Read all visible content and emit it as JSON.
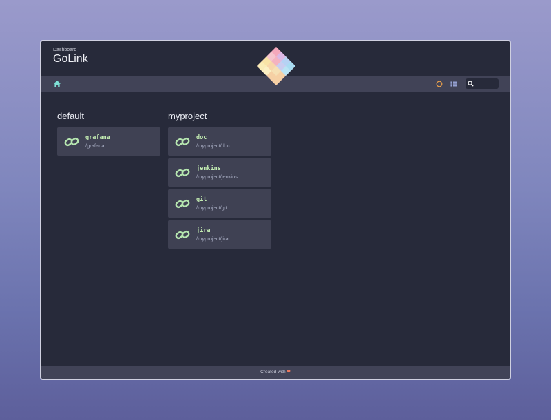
{
  "header": {
    "subtitle": "Dashboard",
    "title": "GoLink"
  },
  "search": {
    "placeholder": ""
  },
  "groups": [
    {
      "title": "default",
      "links": [
        {
          "name": "grafana",
          "path": "/grafana"
        }
      ]
    },
    {
      "title": "myproject",
      "links": [
        {
          "name": "doc",
          "path": "/myproject/doc"
        },
        {
          "name": "jenkins",
          "path": "/myproject/jenkins"
        },
        {
          "name": "git",
          "path": "/myproject/git"
        },
        {
          "name": "jira",
          "path": "/myproject/jira"
        }
      ]
    }
  ],
  "footer": {
    "text": "Created with",
    "heart": "❤"
  },
  "colors": {
    "background": "#272a3a",
    "navbar": "#414357",
    "card": "#3f4153",
    "link_name": "#c3ecb2",
    "link_icon": "#b6e6b0",
    "accent_home": "#7fe0d6",
    "theme_circle": "#f0a34a"
  },
  "icons": {
    "home": "home-icon",
    "theme": "theme-toggle-icon",
    "list": "list-view-icon",
    "search": "search-icon",
    "link": "link-icon",
    "logo": "golink-logo"
  }
}
